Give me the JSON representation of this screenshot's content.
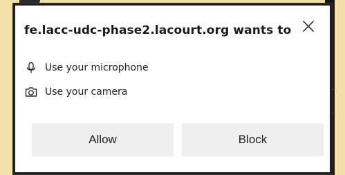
{
  "popup": {
    "title": "fe.lacc-udc-phase2.lacourt.org wants to",
    "close_icon": "close-icon",
    "permissions": [
      {
        "icon": "microphone-icon",
        "label": "Use your microphone"
      },
      {
        "icon": "camera-icon",
        "label": "Use your camera"
      }
    ],
    "buttons": {
      "allow_label": "Allow",
      "block_label": "Block"
    }
  },
  "colors": {
    "page_background": "#f1dfa3",
    "popup_background": "#ffffff",
    "button_background": "#efefef",
    "text": "#202020"
  }
}
